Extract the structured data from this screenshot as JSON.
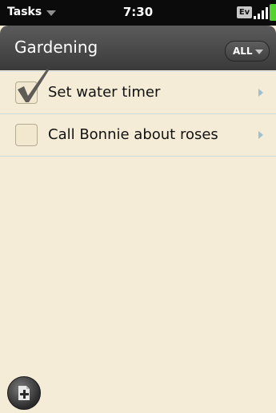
{
  "status_bar": {
    "app_name": "Tasks",
    "time": "7:30",
    "network_label": "Ev",
    "icons": [
      "dropdown-caret-icon",
      "signal-strength-icon",
      "battery-icon"
    ],
    "battery_color": "#52d330"
  },
  "header": {
    "title": "Gardening",
    "filter_label": "ALL",
    "background": "#4a4a4a"
  },
  "tasks": [
    {
      "label": "Set water timer",
      "checked": true
    },
    {
      "label": "Call Bonnie about roses",
      "checked": false
    }
  ],
  "footer": {
    "add_icon": "new-task-icon"
  },
  "colors": {
    "paper": "#f4ecd6",
    "divider": "#c9dbe1",
    "row_arrow": "#9fbfd2"
  }
}
